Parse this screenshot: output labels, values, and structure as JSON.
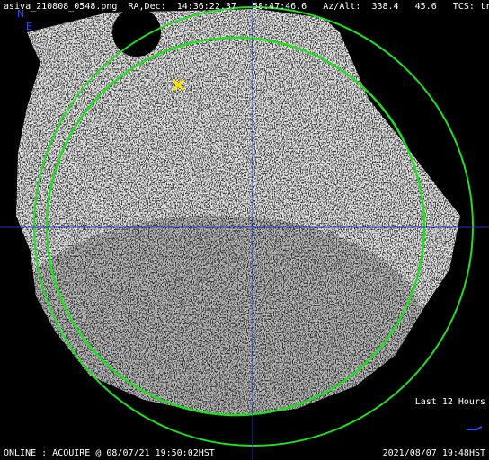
{
  "header": {
    "filename": "asiva_210808_0548.png",
    "radec_label": "RA,Dec:",
    "ra": "14:36:22.37",
    "dec": "58:47:46.6",
    "azalt_label": "Az/Alt:",
    "az": "338.4",
    "alt": "45.6",
    "tcs_label": "TCS:",
    "tcs_value": "track"
  },
  "compass": {
    "north": "N",
    "east": "E",
    "color": "#2e4cff"
  },
  "legend": {
    "label": "Last 12 Hours",
    "color": "#2e4cff"
  },
  "status": {
    "text": "ONLINE : ACQUIRE @ 08/07/21 19:50:02HST"
  },
  "datetime": "2021/08/07 19:48HST",
  "overlay_colors": {
    "circle": "#22dd22",
    "crosshair": "#2233cc",
    "target_marker": "#ffe600"
  },
  "icons": {
    "target": "target-x-icon"
  }
}
